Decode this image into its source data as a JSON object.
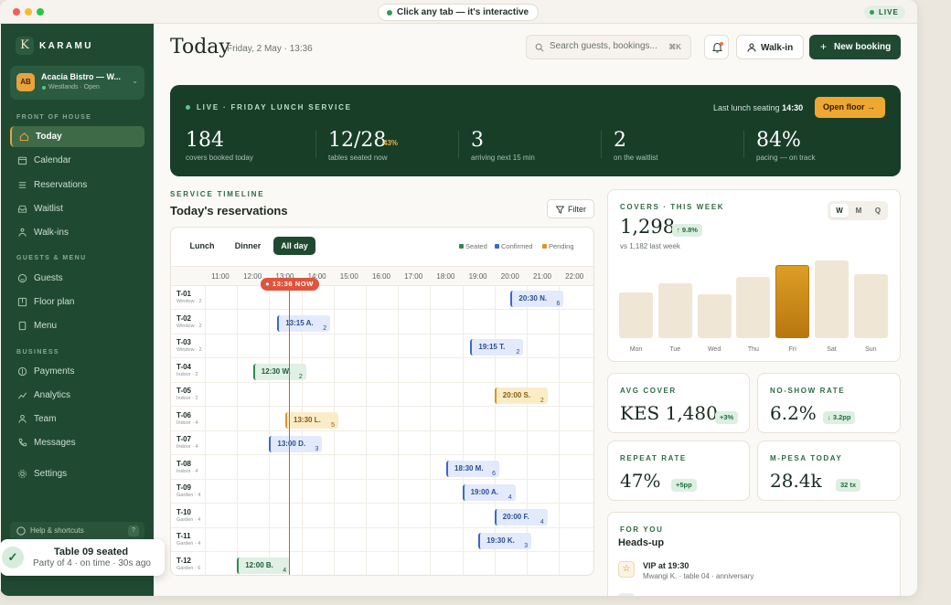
{
  "window": {
    "hint": "Click any tab — it's interactive",
    "live_pill": "LIVE"
  },
  "sidebar": {
    "logo": "K",
    "brand": "KARAMU",
    "venue": {
      "initials": "AB",
      "name": "Acacia Bistro — W...",
      "sub": "Westlands · Open"
    },
    "sections": {
      "front": "FRONT OF HOUSE",
      "guests": "GUESTS & MENU",
      "business": "BUSINESS"
    },
    "items": [
      {
        "label": "Today",
        "icon": "home-icon"
      },
      {
        "label": "Calendar",
        "icon": "calendar-icon"
      },
      {
        "label": "Reservations",
        "icon": "list-icon"
      },
      {
        "label": "Waitlist",
        "icon": "inbox-icon"
      },
      {
        "label": "Walk-ins",
        "icon": "walk-icon"
      },
      {
        "label": "Guests",
        "icon": "smile-icon"
      },
      {
        "label": "Floor plan",
        "icon": "floorplan-icon"
      },
      {
        "label": "Menu",
        "icon": "book-icon"
      },
      {
        "label": "Payments",
        "icon": "dollar-icon"
      },
      {
        "label": "Analytics",
        "icon": "chart-icon"
      },
      {
        "label": "Team",
        "icon": "team-icon"
      },
      {
        "label": "Messages",
        "icon": "phone-icon"
      },
      {
        "label": "Settings",
        "icon": "gear-icon"
      }
    ],
    "help": "Help & shortcuts",
    "help_key": "?"
  },
  "toast": {
    "title": "Table 09 seated",
    "sub": "Party of 4 · on time · 30s ago"
  },
  "header": {
    "title": "Today",
    "date": "Friday, 2 May · 13:36",
    "search_placeholder": "Search guests, bookings...",
    "search_kbd": "⌘K",
    "walkin": "Walk-in",
    "new_booking": "New booking"
  },
  "banner": {
    "label": "LIVE · FRIDAY LUNCH SERVICE",
    "last_seating_prefix": "Last lunch seating",
    "last_seating_time": "14:30",
    "open_floor": "Open floor →",
    "kpis": [
      {
        "value": "184",
        "badge": "",
        "label": "covers booked today"
      },
      {
        "value": "12/28",
        "badge": "43%",
        "label": "tables seated now"
      },
      {
        "value": "3",
        "badge": "",
        "label": "arriving next 15 min"
      },
      {
        "value": "2",
        "badge": "",
        "label": "on the waitlist"
      },
      {
        "value": "84%",
        "badge": "",
        "label": "pacing — on track"
      }
    ]
  },
  "timeline": {
    "eyebrow": "SERVICE TIMELINE",
    "title": "Today's reservations",
    "filter": "Filter",
    "tabs": [
      "Lunch",
      "Dinner",
      "All day"
    ],
    "active_tab": 2,
    "legend": [
      {
        "label": "Seated",
        "color": "#2f8a52"
      },
      {
        "label": "Confirmed",
        "color": "#3a68c9"
      },
      {
        "label": "Pending",
        "color": "#d9962a"
      }
    ],
    "hours": [
      "11:00",
      "12:00",
      "13:00",
      "14:00",
      "15:00",
      "16:00",
      "17:00",
      "18:00",
      "19:00",
      "20:00",
      "21:00",
      "22:00"
    ],
    "now": "● 13:36 NOW",
    "rows": [
      {
        "id": "T-01",
        "zone": "Window · 2",
        "time": "20:30",
        "guest": "N.",
        "party": "6",
        "status": "confirmed"
      },
      {
        "id": "T-02",
        "zone": "Window · 2",
        "time": "13:15",
        "guest": "A.",
        "party": "2",
        "status": "confirmed"
      },
      {
        "id": "T-03",
        "zone": "Window · 2",
        "time": "19:15",
        "guest": "T.",
        "party": "2",
        "status": "confirmed"
      },
      {
        "id": "T-04",
        "zone": "Indoor · 2",
        "time": "12:30",
        "guest": "W.",
        "party": "2",
        "status": "seated"
      },
      {
        "id": "T-05",
        "zone": "Indoor · 2",
        "time": "20:00",
        "guest": "S.",
        "party": "2",
        "status": "pending"
      },
      {
        "id": "T-06",
        "zone": "Indoor · 4",
        "time": "13:30",
        "guest": "L.",
        "party": "5",
        "status": "pending"
      },
      {
        "id": "T-07",
        "zone": "Indoor · 4",
        "time": "13:00",
        "guest": "D.",
        "party": "3",
        "status": "confirmed"
      },
      {
        "id": "T-08",
        "zone": "Indoor · 4",
        "time": "18:30",
        "guest": "M.",
        "party": "6",
        "status": "confirmed"
      },
      {
        "id": "T-09",
        "zone": "Garden · 4",
        "time": "19:00",
        "guest": "A.",
        "party": "4",
        "status": "confirmed"
      },
      {
        "id": "T-10",
        "zone": "Garden · 4",
        "time": "20:00",
        "guest": "F.",
        "party": "4",
        "status": "confirmed"
      },
      {
        "id": "T-11",
        "zone": "Garden · 4",
        "time": "19:30",
        "guest": "K.",
        "party": "3",
        "status": "confirmed"
      },
      {
        "id": "T-12",
        "zone": "Garden · 6",
        "time": "12:00",
        "guest": "B.",
        "party": "4",
        "status": "seated"
      }
    ]
  },
  "covers": {
    "eyebrow": "COVERS · THIS WEEK",
    "value": "1,298",
    "delta": "↑ 9.8%",
    "sub": "vs 1,182 last week",
    "periods": [
      "W",
      "M",
      "Q"
    ],
    "active_period": 0,
    "chart_data": {
      "type": "bar",
      "categories": [
        "Mon",
        "Tue",
        "Wed",
        "Thu",
        "Fri",
        "Sat",
        "Sun"
      ],
      "values": [
        150,
        180,
        145,
        200,
        240,
        255,
        210
      ],
      "highlight": "Fri",
      "title": "",
      "xlabel": "",
      "ylabel": ""
    }
  },
  "stats": [
    {
      "eyebrow": "AVG COVER",
      "value": "KES 1,480",
      "delta": "+3%"
    },
    {
      "eyebrow": "NO-SHOW RATE",
      "value": "6.2%",
      "delta": "↓ 3.2pp"
    },
    {
      "eyebrow": "REPEAT RATE",
      "value": "47%",
      "delta": "+5pp"
    },
    {
      "eyebrow": "M-PESA TODAY",
      "value": "28.4k",
      "delta": "32 tx"
    }
  ],
  "heads_up": {
    "eyebrow": "FOR YOU",
    "title": "Heads-up",
    "item_icon": "star-icon",
    "item_title": "VIP at 19:30",
    "item_sub": "Mwangi K. · table 04 · anniversary"
  }
}
